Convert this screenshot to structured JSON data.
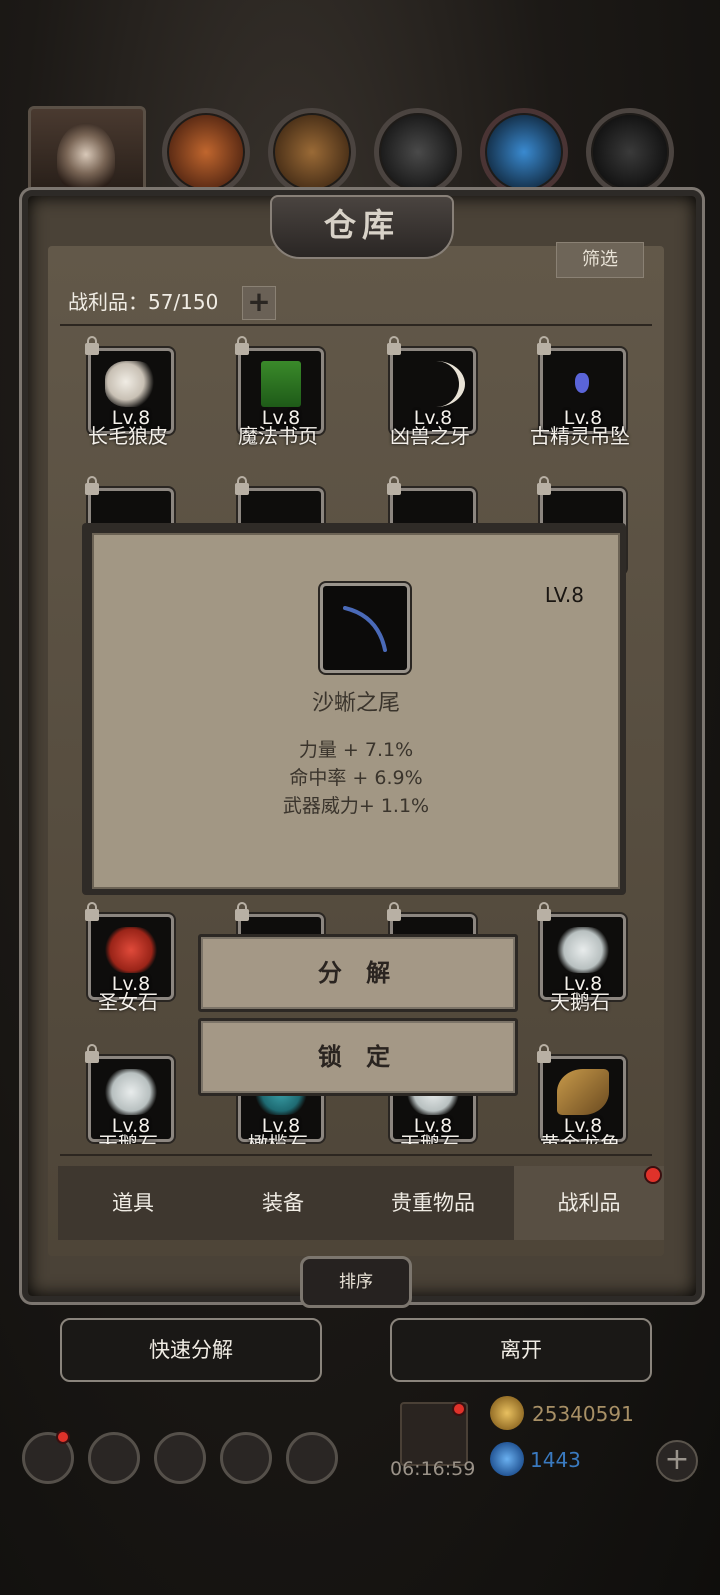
{
  "header": {
    "resource_icons": [
      {
        "icon": "orange-ore-icon",
        "color": "#b05a2a"
      },
      {
        "icon": "wood-plank-icon",
        "color": "#8a5a2e"
      },
      {
        "icon": "iron-ingot-icon",
        "color": "#3a3a3a"
      },
      {
        "icon": "blue-crystal-icon",
        "color": "#2e7ab8"
      },
      {
        "icon": "dark-metal-icon",
        "color": "#2a2a2a"
      }
    ]
  },
  "panel": {
    "title": "仓库",
    "filter_label": "筛选",
    "capacity_text": "战利品：57/150",
    "capacity_plus": "+"
  },
  "items": [
    {
      "name": "长毛狼皮",
      "level": "Lv.8",
      "icon": "wolf-fur-icon"
    },
    {
      "name": "魔法书页",
      "level": "Lv.8",
      "icon": "magic-page-icon"
    },
    {
      "name": "凶兽之牙",
      "level": "Lv.8",
      "icon": "beast-fang-icon"
    },
    {
      "name": "古精灵吊坠",
      "level": "Lv.8",
      "icon": "elf-pendant-icon"
    },
    {
      "name": "圣女石",
      "level": "Lv.8",
      "icon": "red-stone-icon"
    },
    {
      "name": "天鹅石",
      "level": "Lv.8",
      "icon": "white-stone-icon"
    },
    {
      "name": "天鹅石",
      "level": "Lv.8",
      "icon": "white-stone-icon"
    },
    {
      "name": "橄榄石",
      "level": "Lv.8",
      "icon": "teal-stone-icon"
    },
    {
      "name": "天鹅石",
      "level": "Lv.8",
      "icon": "white-stone-icon"
    },
    {
      "name": "黄金龙角",
      "level": "Lv.8",
      "icon": "golden-horn-icon"
    }
  ],
  "tooltip": {
    "level": "LV.8",
    "name": "沙蜥之尾",
    "icon": "lizard-tail-icon",
    "stats": [
      "力量 + 7.1%",
      "命中率 + 6.9%",
      "武器威力+ 1.1%"
    ]
  },
  "actions": {
    "decompose": "分 解",
    "lock": "锁 定"
  },
  "tabs": [
    {
      "label": "道具"
    },
    {
      "label": "装备"
    },
    {
      "label": "贵重物品"
    },
    {
      "label": "战利品",
      "active": true
    }
  ],
  "sort_label": "排序",
  "bottom": {
    "quick_decompose": "快速分解",
    "leave": "离开"
  },
  "currency": {
    "gold": "25340591",
    "gems": "1443",
    "timer": "06:16:59",
    "gold_color": "#c89a3a",
    "gem_color": "#2a7ac0"
  }
}
